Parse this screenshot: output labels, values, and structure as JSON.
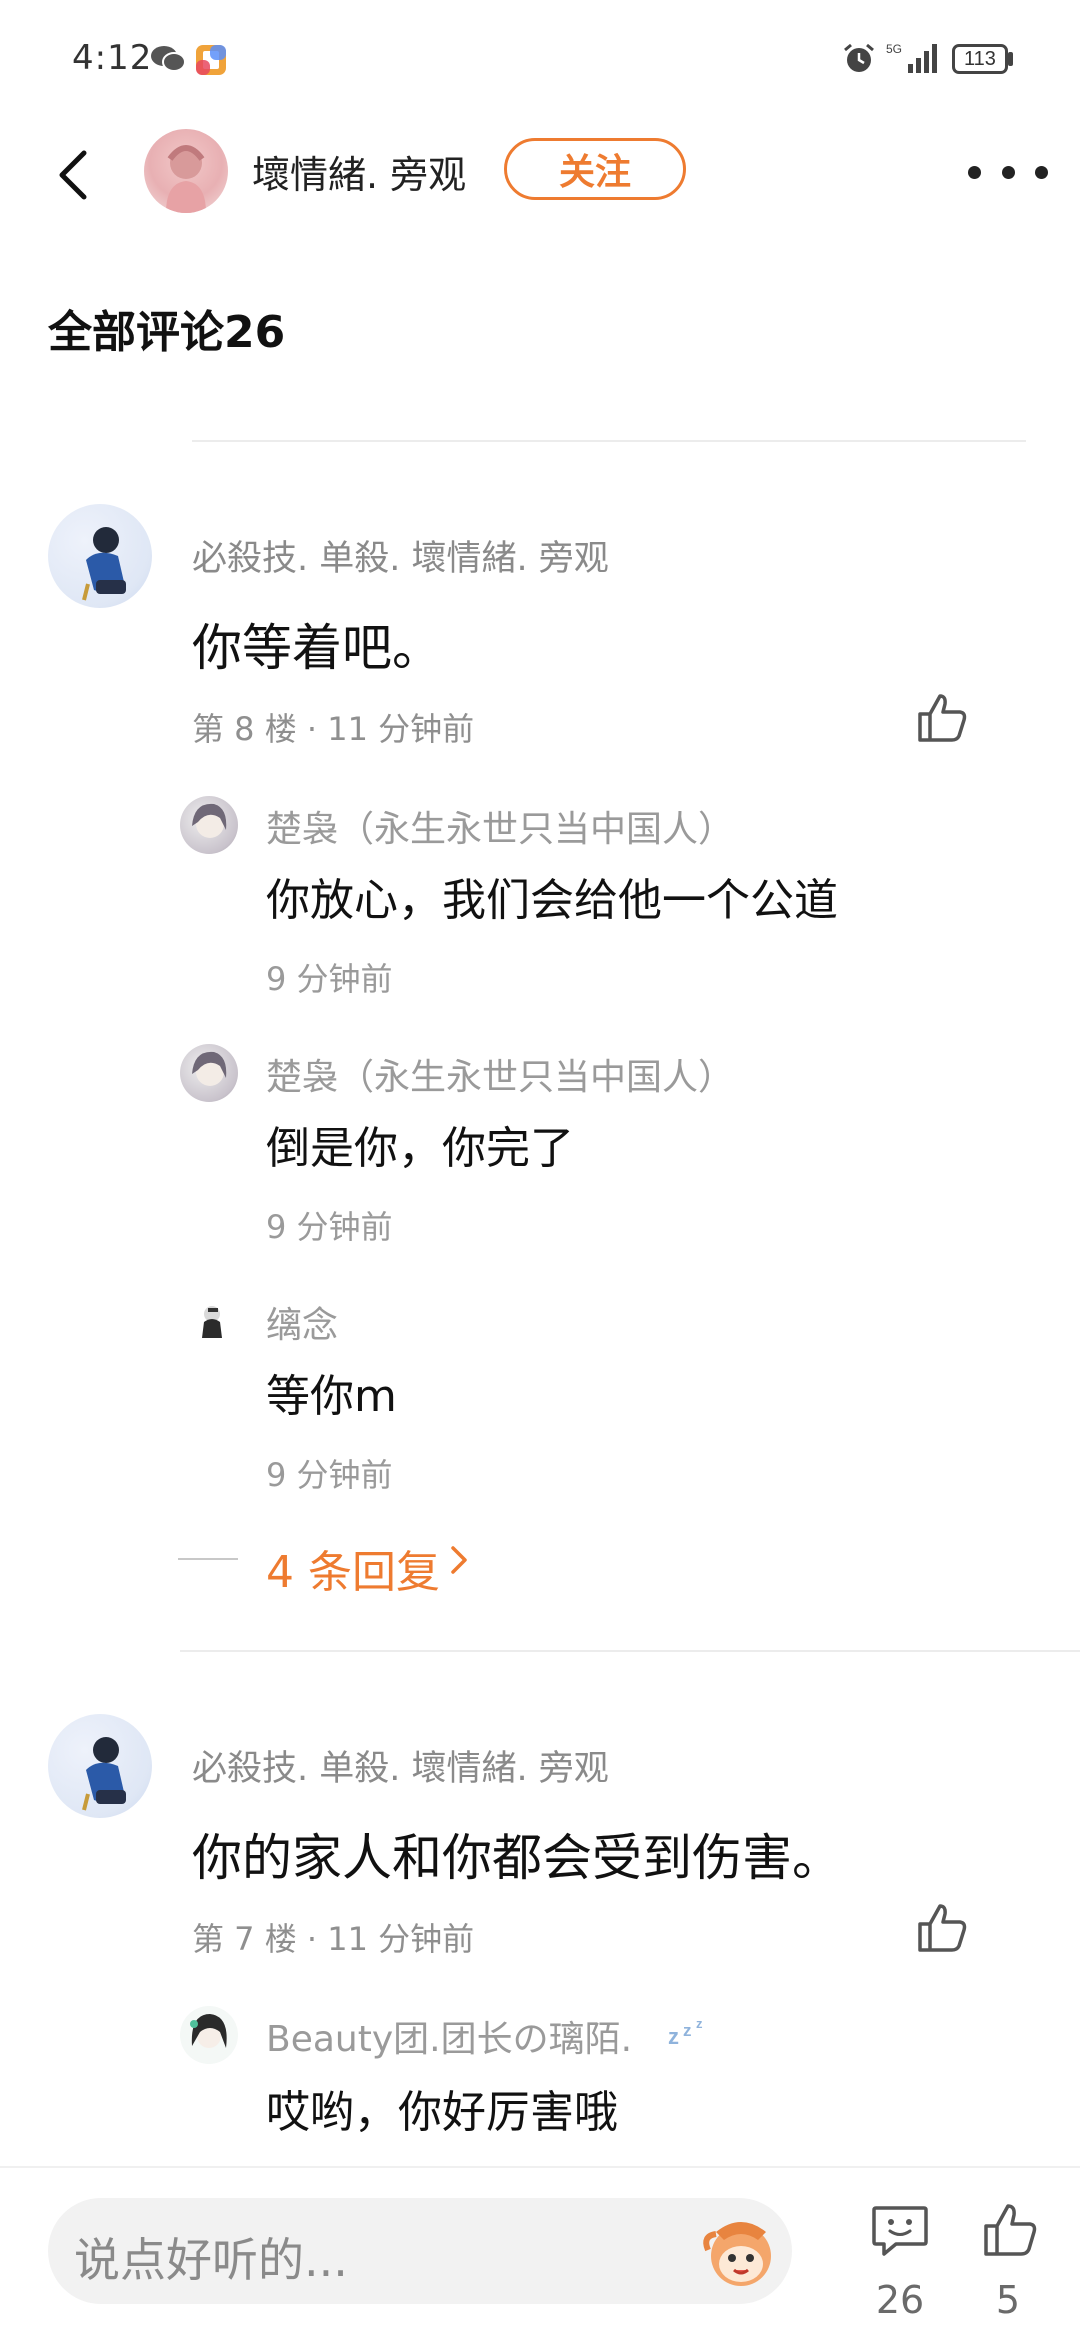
{
  "status_bar": {
    "time": "4:12",
    "network": "5G",
    "battery": "113"
  },
  "header": {
    "username": "壞情緒. 旁观",
    "follow_label": "关注"
  },
  "section_title": "全部评论26",
  "comments": [
    {
      "author": "必殺技. 单殺. 壞情緒. 旁观",
      "text": "你等着吧。",
      "floor": "第 8 楼 · 11 分钟前",
      "replies": [
        {
          "author": "楚袅（永生永世只当中国人）",
          "text": "你放心，我们会给他一个公道",
          "time": "9 分钟前"
        },
        {
          "author": "楚袅（永生永世只当中国人）",
          "text": "倒是你，你完了",
          "time": "9 分钟前"
        },
        {
          "author": "缡念",
          "text": "等你m",
          "time": "9 分钟前"
        }
      ],
      "more_replies": "4 条回复"
    },
    {
      "author": "必殺技. 单殺. 壞情緒. 旁观",
      "text": "你的家人和你都会受到伤害。",
      "floor": "第 7 楼 · 11 分钟前",
      "replies": [
        {
          "author": "Beauty团.团长の璃陌.",
          "text": "哎哟，你好厉害哦"
        }
      ]
    }
  ],
  "bottom_bar": {
    "input_placeholder": "说点好听的...",
    "comment_count": "26",
    "like_count": "5"
  },
  "colors": {
    "accent": "#ee7b30",
    "secondary_text": "#8a8a8a"
  }
}
